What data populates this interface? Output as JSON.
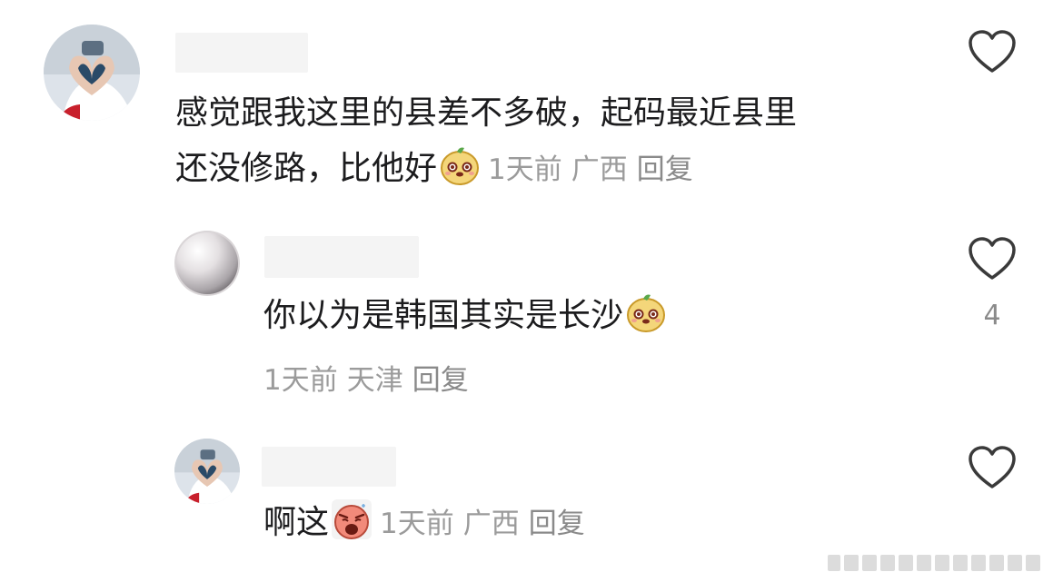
{
  "comments": [
    {
      "text_line1": "感觉跟我这里的县差不多破，起码最近县里",
      "text_line2": "还没修路，比他好",
      "emoji": "smile-pear-emoji",
      "time": "1天前",
      "location": "广西",
      "reply": "回复"
    },
    {
      "text": "你以为是韩国其实是长沙",
      "emoji": "smile-pear-emoji",
      "time": "1天前",
      "location": "天津",
      "reply": "回复",
      "likes": "4"
    },
    {
      "text": "啊这",
      "emoji": "scared-face-emoji",
      "time": "1天前",
      "location": "广西",
      "reply": "回复"
    }
  ],
  "icons": {
    "like": "heart-outline-icon",
    "avatar_1": "heart-hands-avatar",
    "avatar_2": "pearl-avatar",
    "avatar_3": "heart-hands-avatar"
  },
  "colors": {
    "text": "#1c1c1e",
    "meta": "#9b9b9b",
    "heart_stroke": "#3a3a3a",
    "name_placeholder": "#f4f4f4"
  }
}
